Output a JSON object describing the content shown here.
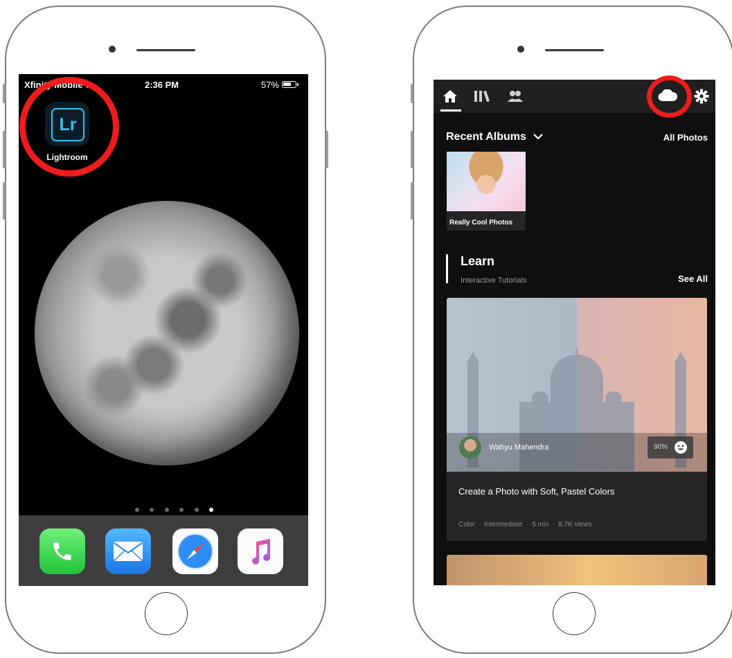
{
  "left_phone": {
    "status_bar": {
      "carrier": "Xfinity Mobile",
      "time": "2:36 PM",
      "battery_pct": "57%"
    },
    "home_screen": {
      "app_label": "Lightroom",
      "app_icon_text": "Lr",
      "page_count": 6,
      "active_page": 6
    },
    "dock": [
      "phone-icon",
      "mail-icon",
      "safari-icon",
      "music-icon"
    ]
  },
  "right_phone": {
    "topbar_tabs": [
      "home-icon",
      "library-icon",
      "people-icon"
    ],
    "topbar_actions": [
      "cloud-icon",
      "gear-icon"
    ],
    "recent_albums": {
      "heading": "Recent Albums",
      "all_photos": "All Photos",
      "albums": [
        {
          "name": "Really Cool Photos"
        }
      ]
    },
    "learn": {
      "title": "Learn",
      "subtitle": "Interactive Tutorials",
      "see_all": "See All",
      "tutorial": {
        "author": "Wahyu Mahendra",
        "score": "90%",
        "title": "Create a Photo with Soft, Pastel Colors",
        "meta": [
          "Color",
          "Intermediate",
          "5 min",
          "8.7K views"
        ]
      }
    }
  },
  "colors": {
    "highlight": "#ee1c1c",
    "lightroom_accent": "#35c4f0",
    "lightroom_bg": "#0c1d28"
  }
}
